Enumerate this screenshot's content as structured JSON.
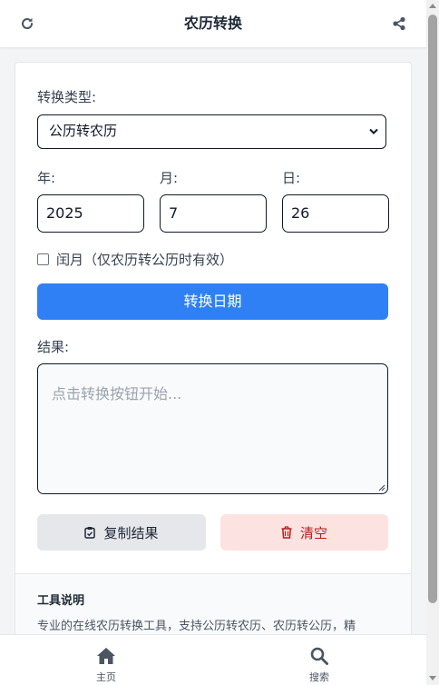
{
  "header": {
    "title": "农历转换",
    "refresh_icon": "refresh-icon",
    "share_icon": "share-icon"
  },
  "form": {
    "type_label": "转换类型:",
    "type_selected": "公历转农历",
    "year_label": "年:",
    "month_label": "月:",
    "day_label": "日:",
    "year_value": "2025",
    "month_value": "7",
    "day_value": "26",
    "leap_label": "闰月（仅农历转公历时有效）",
    "leap_checked": false,
    "convert_label": "转换日期",
    "result_label": "结果:",
    "result_placeholder": "点击转换按钮开始...",
    "copy_label": "复制结果",
    "clear_label": "清空"
  },
  "description": {
    "title": "工具说明",
    "text": "专业的在线农历转换工具，支持公历转农历、农历转公历，精"
  },
  "bottom_nav": {
    "items": [
      {
        "label": "主页",
        "icon": "home-icon"
      },
      {
        "label": "搜索",
        "icon": "search-icon"
      }
    ]
  },
  "colors": {
    "primary": "#2f80f5",
    "danger_bg": "#fde2e2",
    "danger_text": "#b91c1c",
    "neutral_btn": "#e5e7eb"
  }
}
